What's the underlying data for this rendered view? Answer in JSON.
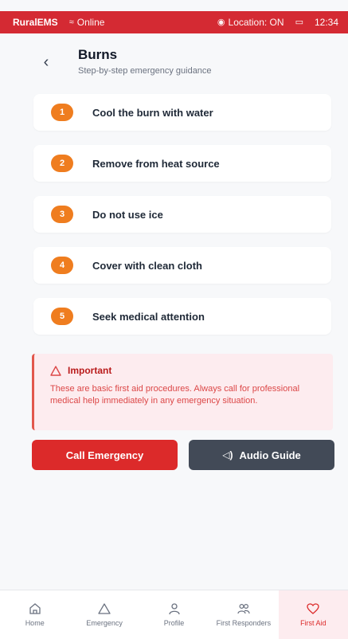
{
  "status_bar": {
    "app_name": "RuralEMS",
    "online": "Online",
    "location": "Location: ON",
    "time": "12:34"
  },
  "header": {
    "title": "Burns",
    "subtitle": "Step-by-step emergency guidance"
  },
  "steps": [
    {
      "num": "1",
      "text": "Cool the burn with water"
    },
    {
      "num": "2",
      "text": "Remove from heat source"
    },
    {
      "num": "3",
      "text": "Do not use ice"
    },
    {
      "num": "4",
      "text": "Cover with clean cloth"
    },
    {
      "num": "5",
      "text": "Seek medical attention"
    }
  ],
  "alert": {
    "title": "Important",
    "body": "These are basic first aid procedures. Always call for professional medical help immediately in any emergency situation."
  },
  "actions": {
    "call": "Call Emergency",
    "audio": "Audio Guide"
  },
  "nav": [
    {
      "label": "Home",
      "icon": "home-icon"
    },
    {
      "label": "Emergency",
      "icon": "warning-icon"
    },
    {
      "label": "Profile",
      "icon": "user-icon"
    },
    {
      "label": "First Responders",
      "icon": "people-icon"
    },
    {
      "label": "First Aid",
      "icon": "heart-icon",
      "active": true
    }
  ],
  "colors": {
    "brand": "#d42a33",
    "step_badge": "#ef7d1f",
    "alert_bg": "#fdecef",
    "audio_btn": "#424a57"
  }
}
